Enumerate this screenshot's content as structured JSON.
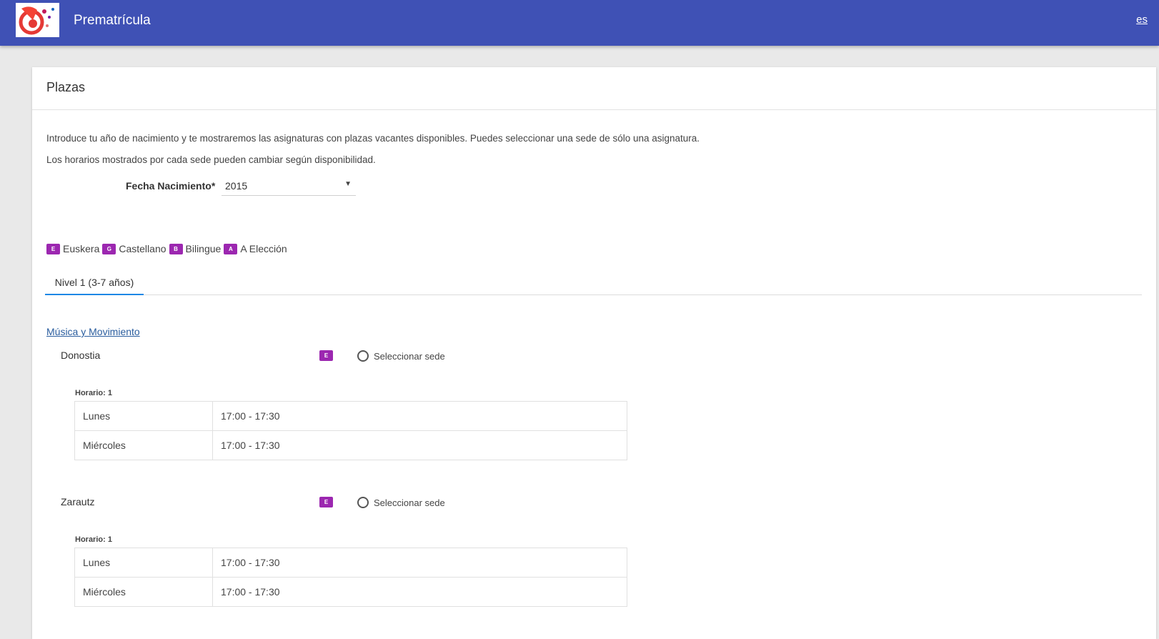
{
  "header": {
    "title": "Prematrícula",
    "language": "es",
    "logo_icon": "school-logo"
  },
  "card": {
    "title": "Plazas",
    "intro_line1": "Introduce tu año de nacimiento y te mostraremos las asignaturas con plazas vacantes disponibles. Puedes seleccionar una sede de sólo una asignatura.",
    "intro_line2": "Los horarios mostrados por cada sede pueden cambiar según disponibilidad.",
    "birth": {
      "label": "Fecha Nacimiento*",
      "value": "2015"
    },
    "legend": [
      {
        "code": "E",
        "label": "Euskera"
      },
      {
        "code": "G",
        "label": "Castellano"
      },
      {
        "code": "B",
        "label": "Bilingue"
      },
      {
        "code": "A",
        "label": "A Elección"
      }
    ],
    "tabs": [
      {
        "label": "Nivel 1 (3-7 años)"
      }
    ],
    "subject": "Música y Movimiento",
    "sedes": [
      {
        "name": "Donostia",
        "badge": "E",
        "select_label": "Seleccionar sede",
        "horario_title": "Horario: 1",
        "rows": [
          {
            "day": "Lunes",
            "time": "17:00 - 17:30"
          },
          {
            "day": "Miércoles",
            "time": "17:00 - 17:30"
          }
        ]
      },
      {
        "name": "Zarautz",
        "badge": "E",
        "select_label": "Seleccionar sede",
        "horario_title": "Horario: 1",
        "rows": [
          {
            "day": "Lunes",
            "time": "17:00 - 17:30"
          },
          {
            "day": "Miércoles",
            "time": "17:00 - 17:30"
          }
        ]
      }
    ]
  },
  "colors": {
    "topbar": "#3f51b5",
    "badge": "#9c27b0",
    "tab_underline": "#1e88e5",
    "link": "#2a5d9e"
  }
}
